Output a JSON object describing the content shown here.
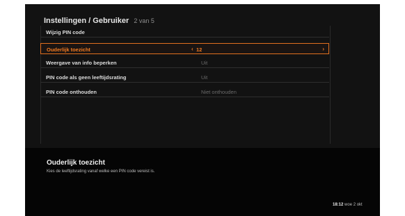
{
  "header": {
    "title": "Instellingen / Gebruiker",
    "subtitle": "2 van 5"
  },
  "settings": {
    "rows": [
      {
        "label": "Wijzig PIN code",
        "value": ""
      },
      {
        "label": "Ouderlijk toezicht",
        "value": "12"
      },
      {
        "label": "Weergave van info beperken",
        "value": "Uit"
      },
      {
        "label": "PIN code als geen leeftijdsrating",
        "value": "Uit"
      },
      {
        "label": "PIN code onthouden",
        "value": "Niet onthouden"
      }
    ]
  },
  "description": {
    "title": "Ouderlijk toezicht",
    "text": "Kies de leeftijdsrating vanaf welke een PIN code vereist is."
  },
  "status": {
    "time": "18:12",
    "info": "woe 2 okt"
  },
  "colors": {
    "accent": "#e2701f",
    "background": "#121212",
    "footer": "#050505"
  },
  "icons": {
    "left_arrow": "‹",
    "right_arrow": "›"
  }
}
